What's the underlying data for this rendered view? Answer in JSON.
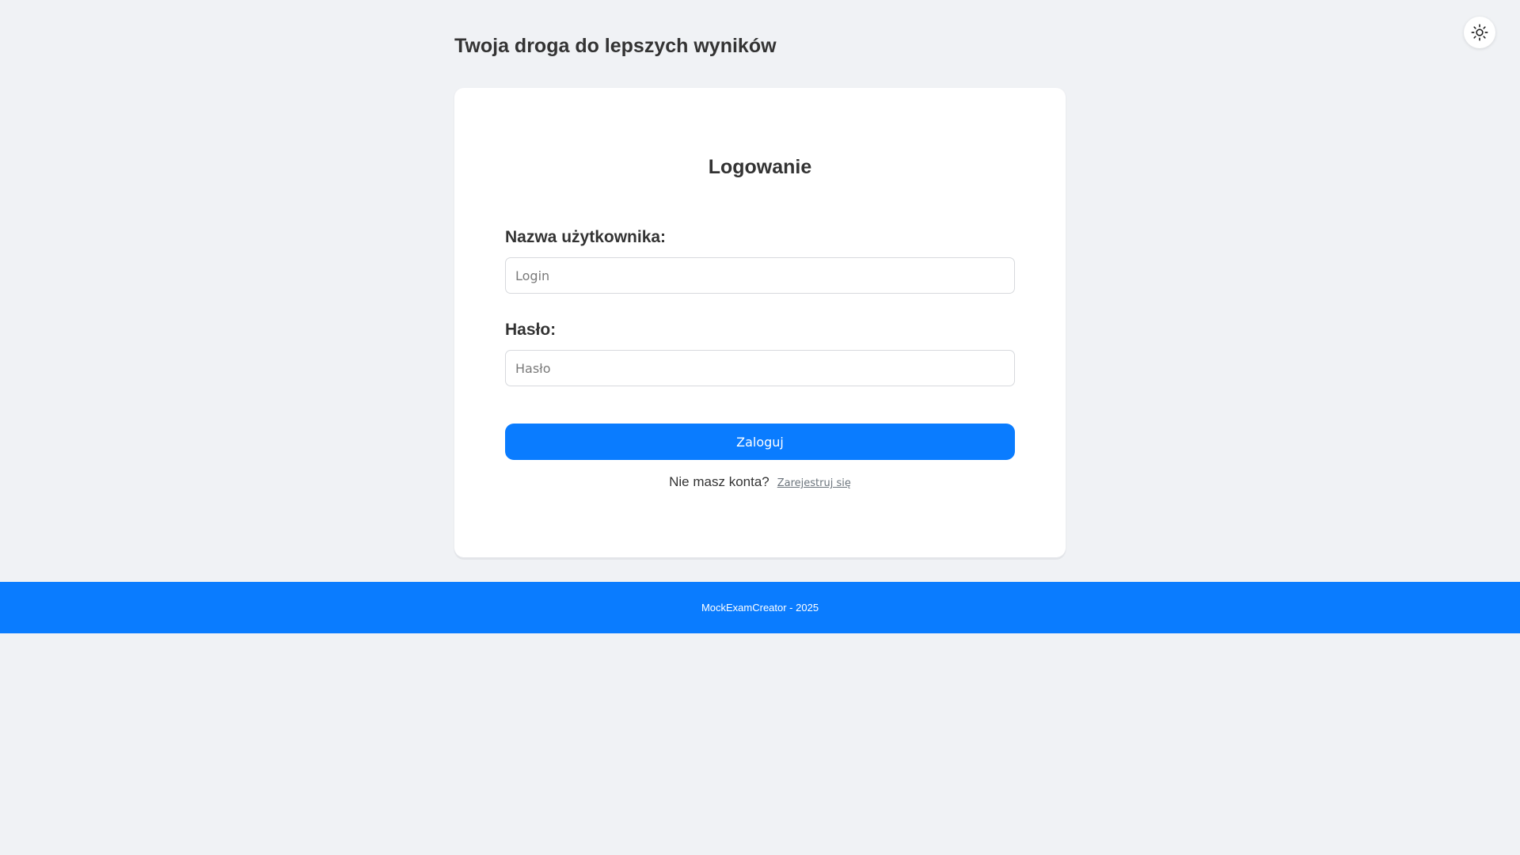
{
  "header": {
    "title": "Twoja droga do lepszych wyników",
    "theme_toggle_icon": "sun-icon"
  },
  "login_card": {
    "title": "Logowanie",
    "username": {
      "label": "Nazwa użytkownika:",
      "value": "",
      "placeholder": "Login"
    },
    "password": {
      "label": "Hasło:",
      "value": "",
      "placeholder": "Hasło"
    },
    "submit_label": "Zaloguj",
    "register_prompt": "Nie masz konta?",
    "register_link": "Zarejestruj się"
  },
  "footer": {
    "text": "MockExamCreator - 2025"
  },
  "colors": {
    "background": "#f0f2f5",
    "accent": "#0a7cff",
    "card": "#ffffff",
    "text": "#333333",
    "link": "#6c757d"
  }
}
